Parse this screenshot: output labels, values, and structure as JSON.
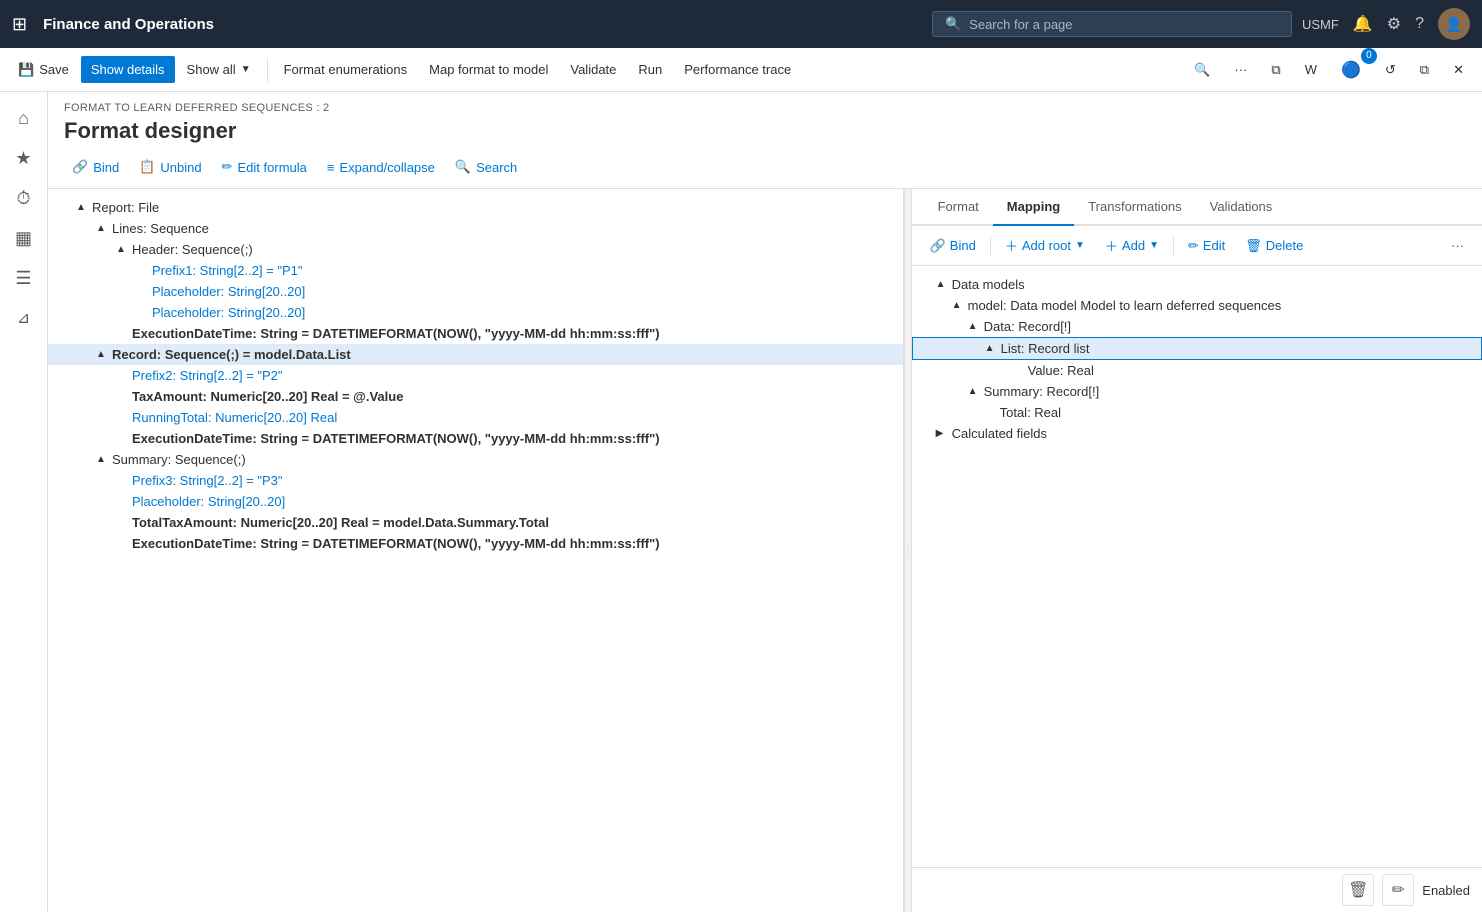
{
  "app": {
    "title": "Finance and Operations",
    "search_placeholder": "Search for a page",
    "user": "USMF",
    "notification_count": "0"
  },
  "toolbar": {
    "save_label": "Save",
    "show_details_label": "Show details",
    "show_all_label": "Show all",
    "format_enumerations_label": "Format enumerations",
    "map_format_to_model_label": "Map format to model",
    "validate_label": "Validate",
    "run_label": "Run",
    "performance_trace_label": "Performance trace"
  },
  "page": {
    "breadcrumb": "FORMAT TO LEARN DEFERRED SEQUENCES : 2",
    "title": "Format designer"
  },
  "inner_toolbar": {
    "bind_label": "Bind",
    "unbind_label": "Unbind",
    "edit_formula_label": "Edit formula",
    "expand_collapse_label": "Expand/collapse",
    "search_label": "Search"
  },
  "mapping_tabs": {
    "format_label": "Format",
    "mapping_label": "Mapping",
    "transformations_label": "Transformations",
    "validations_label": "Validations"
  },
  "mapping_toolbar": {
    "bind_label": "Bind",
    "add_root_label": "Add root",
    "add_label": "Add",
    "edit_label": "Edit",
    "delete_label": "Delete"
  },
  "tree_items": [
    {
      "id": "report",
      "indent": 1,
      "toggle": "▲",
      "text": "Report: File",
      "bold": false,
      "muted": false,
      "selected": false
    },
    {
      "id": "lines",
      "indent": 2,
      "toggle": "▲",
      "text": "Lines: Sequence",
      "bold": false,
      "muted": false,
      "selected": false
    },
    {
      "id": "header",
      "indent": 3,
      "toggle": "▲",
      "text": "Header: Sequence(;)",
      "bold": false,
      "muted": false,
      "selected": false
    },
    {
      "id": "prefix1",
      "indent": 4,
      "toggle": "",
      "text": "Prefix1: String[2..2] = \"P1\"",
      "bold": false,
      "muted": true,
      "selected": false
    },
    {
      "id": "placeholder1",
      "indent": 4,
      "toggle": "",
      "text": "Placeholder: String[20..20]",
      "bold": false,
      "muted": true,
      "selected": false
    },
    {
      "id": "placeholder2",
      "indent": 4,
      "toggle": "",
      "text": "Placeholder: String[20..20]",
      "bold": false,
      "muted": true,
      "selected": false
    },
    {
      "id": "execdate1",
      "indent": 3,
      "toggle": "",
      "text": "ExecutionDateTime: String = DATETIMEFORMAT(NOW(), \"yyyy-MM-dd hh:mm:ss:fff\")",
      "bold": true,
      "muted": false,
      "selected": false
    },
    {
      "id": "record",
      "indent": 2,
      "toggle": "▲",
      "text": "Record: Sequence(;) = model.Data.List",
      "bold": true,
      "muted": false,
      "selected": true
    },
    {
      "id": "prefix2",
      "indent": 3,
      "toggle": "",
      "text": "Prefix2: String[2..2] = \"P2\"",
      "bold": false,
      "muted": true,
      "selected": false
    },
    {
      "id": "taxamount",
      "indent": 3,
      "toggle": "",
      "text": "TaxAmount: Numeric[20..20] Real = @.Value",
      "bold": true,
      "muted": false,
      "selected": false
    },
    {
      "id": "runningtotal",
      "indent": 3,
      "toggle": "",
      "text": "RunningTotal: Numeric[20..20] Real",
      "bold": false,
      "muted": true,
      "selected": false
    },
    {
      "id": "execdate2",
      "indent": 3,
      "toggle": "",
      "text": "ExecutionDateTime: String = DATETIMEFORMAT(NOW(), \"yyyy-MM-dd hh:mm:ss:fff\")",
      "bold": true,
      "muted": false,
      "selected": false
    },
    {
      "id": "summary",
      "indent": 2,
      "toggle": "▲",
      "text": "Summary: Sequence(;)",
      "bold": false,
      "muted": false,
      "selected": false
    },
    {
      "id": "prefix3",
      "indent": 3,
      "toggle": "",
      "text": "Prefix3: String[2..2] = \"P3\"",
      "bold": false,
      "muted": true,
      "selected": false
    },
    {
      "id": "placeholder3",
      "indent": 3,
      "toggle": "",
      "text": "Placeholder: String[20..20]",
      "bold": false,
      "muted": true,
      "selected": false
    },
    {
      "id": "totaltax",
      "indent": 3,
      "toggle": "",
      "text": "TotalTaxAmount: Numeric[20..20] Real = model.Data.Summary.Total",
      "bold": true,
      "muted": false,
      "selected": false
    },
    {
      "id": "execdate3",
      "indent": 3,
      "toggle": "",
      "text": "ExecutionDateTime: String = DATETIMEFORMAT(NOW(), \"yyyy-MM-dd hh:mm:ss:fff\")",
      "bold": true,
      "muted": false,
      "selected": false
    }
  ],
  "mapping_tree_items": [
    {
      "id": "data_models",
      "indent": 1,
      "toggle": "▲",
      "text": "Data models",
      "selected": false
    },
    {
      "id": "model",
      "indent": 2,
      "toggle": "▲",
      "text": "model: Data model Model to learn deferred sequences",
      "selected": false
    },
    {
      "id": "data_record",
      "indent": 3,
      "toggle": "▲",
      "text": "Data: Record[!]",
      "selected": false
    },
    {
      "id": "list_record",
      "indent": 4,
      "toggle": "▲",
      "text": "List: Record list",
      "selected": true
    },
    {
      "id": "value",
      "indent": 5,
      "toggle": "",
      "text": "Value: Real",
      "selected": false
    },
    {
      "id": "summary_record",
      "indent": 3,
      "toggle": "▲",
      "text": "Summary: Record[!]",
      "selected": false
    },
    {
      "id": "total",
      "indent": 4,
      "toggle": "",
      "text": "Total: Real",
      "selected": false
    },
    {
      "id": "calculated_fields",
      "indent": 1,
      "toggle": "▶",
      "text": "Calculated fields",
      "selected": false
    }
  ],
  "bottom_bar": {
    "status_label": "Enabled"
  }
}
